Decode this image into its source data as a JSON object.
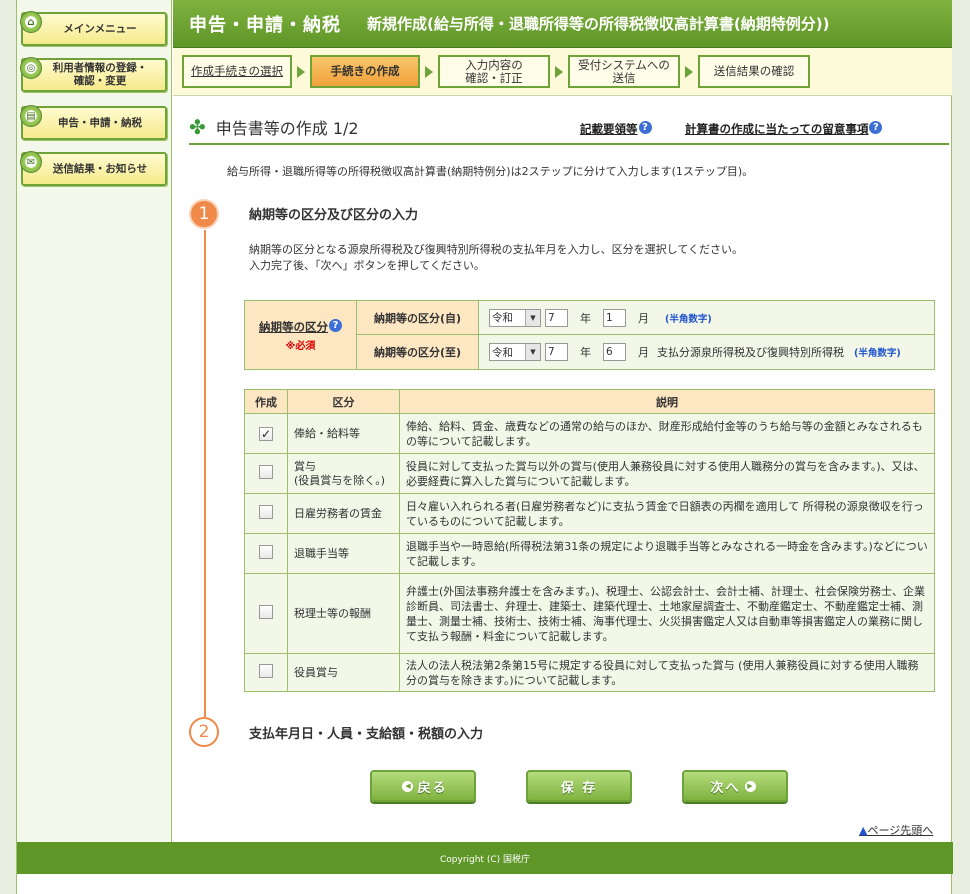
{
  "sidebar": {
    "items": [
      {
        "label": "メインメニュー",
        "icon": "house-icon"
      },
      {
        "label": "利用者情報の登録・\n確認・変更",
        "icon": "target-icon"
      },
      {
        "label": "申告・申請・納税",
        "icon": "document-icon"
      },
      {
        "label": "送信結果・お知らせ",
        "icon": "mail-icon"
      }
    ]
  },
  "header": {
    "main": "申告・申請・納税",
    "sub": "新規作成(給与所得・退職所得等の所得税徴収高計算書(納期特例分))"
  },
  "steps": [
    {
      "label": "作成手続きの選択"
    },
    {
      "label": "手続きの作成"
    },
    {
      "label": "入力内容の\n確認・訂正"
    },
    {
      "label": "受付システムへの\n送信"
    },
    {
      "label": "送信結果の確認"
    }
  ],
  "section": {
    "title": "申告書等の作成 1/2",
    "help1": "記載要領等",
    "help2": "計算書の作成に当たっての留意事項",
    "intro": "給与所得・退職所得等の所得税徴収高計算書(納期特例分)は2ステップに分けて入力します(1ステップ目)。"
  },
  "step1": {
    "num": "1",
    "heading": "納期等の区分及び区分の入力",
    "instr1": "納期等の区分となる源泉所得税及び復興特別所得税の支払年月を入力し、区分を選択してください。",
    "instr2": "入力完了後、「次へ」ボタンを押してください。"
  },
  "period": {
    "label": "納期等の区分",
    "required": "※必須",
    "from": {
      "label": "納期等の区分(自)",
      "era": "令和",
      "year": "7",
      "month": "1",
      "year_unit": "年",
      "month_unit": "月",
      "hint": "(半角数字)",
      "note": ""
    },
    "to": {
      "label": "納期等の区分(至)",
      "era": "令和",
      "year": "7",
      "month": "6",
      "year_unit": "年",
      "month_unit": "月",
      "hint": "(半角数字)",
      "note": "支払分源泉所得税及び復興特別所得税"
    }
  },
  "table": {
    "headers": [
      "作成",
      "区分",
      "説明"
    ],
    "rows": [
      {
        "checked": true,
        "category": "俸給・給料等",
        "desc": "俸給、給料、賃金、歳費などの通常の給与のほか、財産形成給付金等のうち給与等の金額とみなされるもの等について記載します。"
      },
      {
        "checked": false,
        "category": "賞与\n(役員賞与を除く。)",
        "desc": "役員に対して支払った賞与以外の賞与(使用人兼務役員に対する使用人職務分の賞与を含みます。)、又は、必要経費に算入した賞与について記載します。"
      },
      {
        "checked": false,
        "category": "日雇労務者の賃金",
        "desc": "日々雇い入れられる者(日雇労務者など)に支払う賃金で日額表の丙欄を適用して 所得税の源泉徴収を行っているものについて記載します。"
      },
      {
        "checked": false,
        "category": "退職手当等",
        "desc": "退職手当や一時恩給(所得税法第31条の規定により退職手当等とみなされる一時金を含みます。)などについて記載します。"
      },
      {
        "checked": false,
        "category": "税理士等の報酬",
        "desc": "弁護士(外国法事務弁護士を含みます。)、税理士、公認会計士、会計士補、計理士、社会保険労務士、企業診断員、司法書士、弁理士、建築士、建築代理士、土地家屋調査士、不動産鑑定士、不動産鑑定士補、測量士、測量士補、技術士、技術士補、海事代理士、火災損害鑑定人又は自動車等損害鑑定人の業務に関して支払う報酬・料金について記載します。"
      },
      {
        "checked": false,
        "category": "役員賞与",
        "desc": "法人の法人税法第2条第15号に規定する役員に対して支払った賞与 (使用人兼務役員に対する使用人職務分の賞与を除きます。)について記載します。"
      }
    ]
  },
  "step2": {
    "num": "2",
    "heading": "支払年月日・人員・支給額・税額の入力"
  },
  "buttons": {
    "back": "戻る",
    "save": "保 存",
    "next": "次へ"
  },
  "pagetop": "ページ先頭へ",
  "footer": "Copyright (C) 国税庁",
  "colors": {
    "header_green": "#6ea33a",
    "accent_orange": "#f08a4b",
    "table_head": "#fde6c2"
  }
}
